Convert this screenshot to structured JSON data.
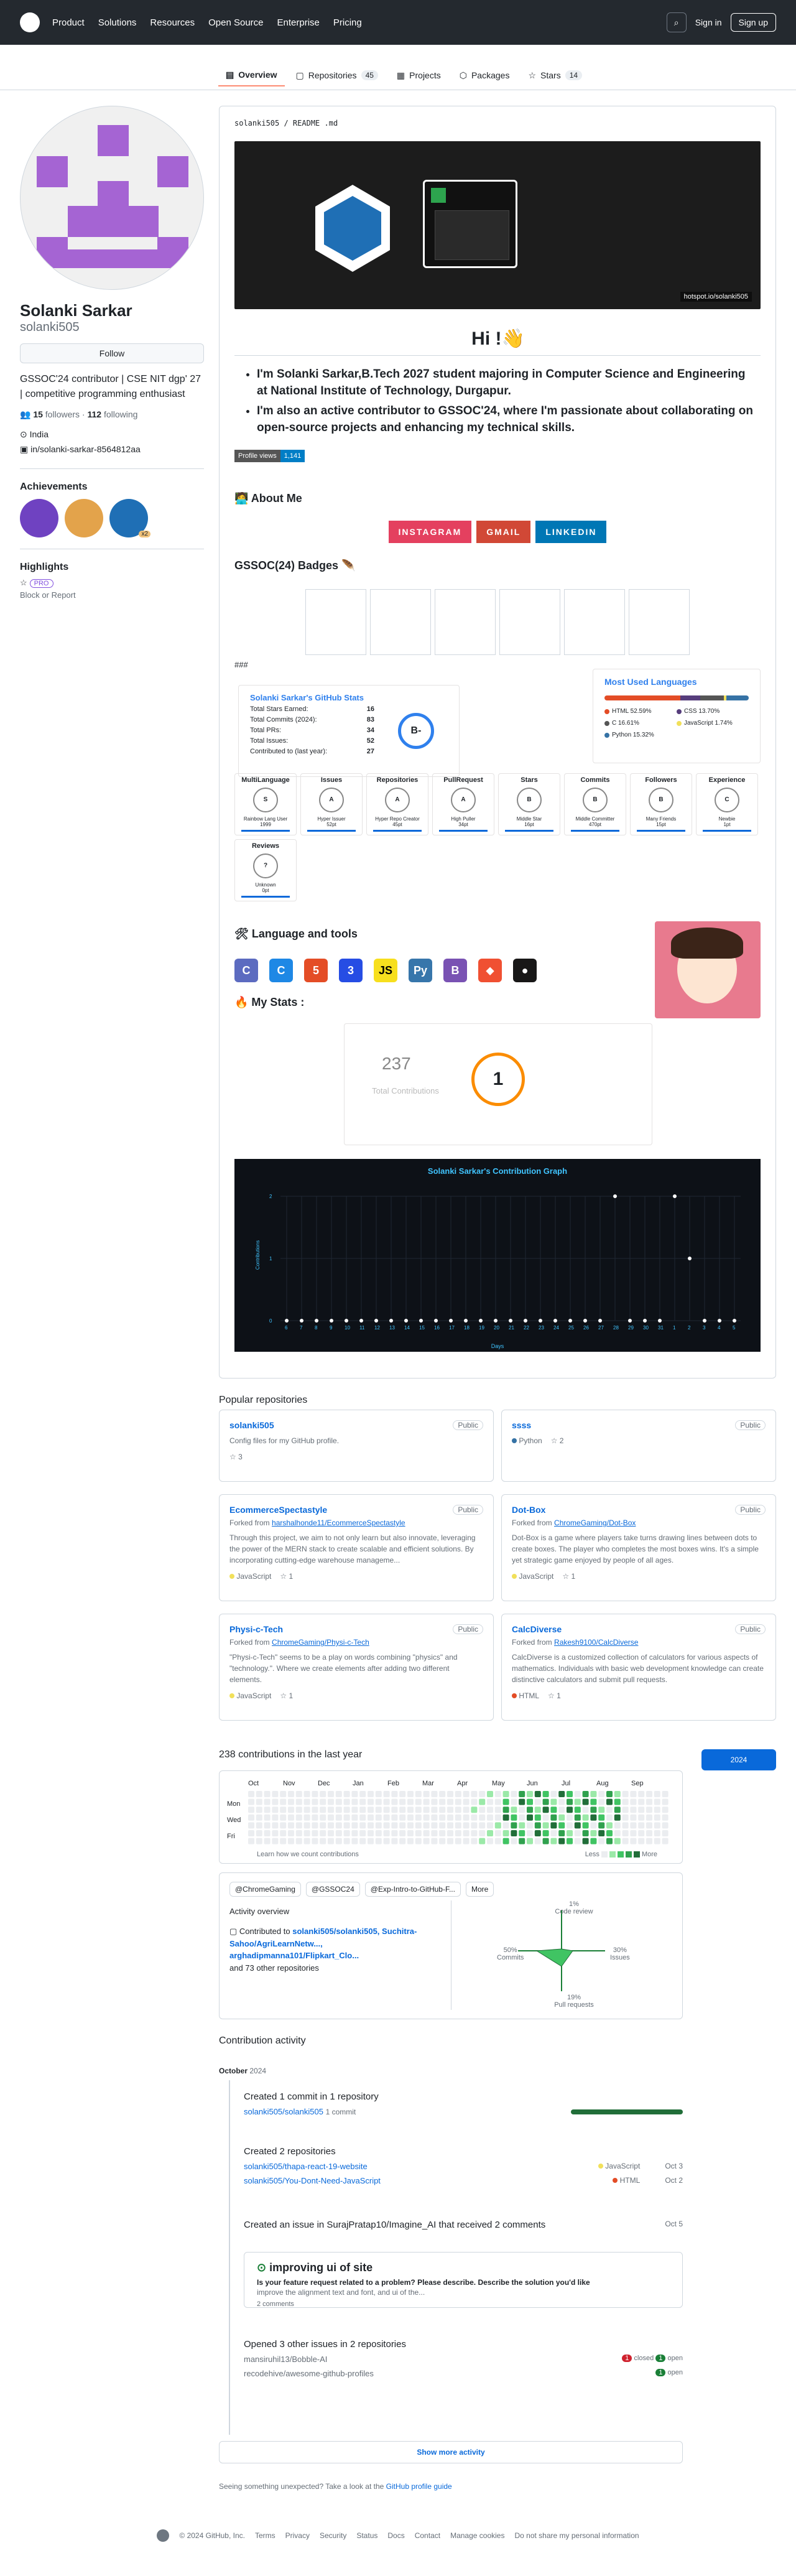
{
  "header": {
    "nav": [
      "Product",
      "Solutions",
      "Resources",
      "Open Source",
      "Enterprise",
      "Pricing"
    ],
    "sign_in": "Sign in",
    "sign_up": "Sign up"
  },
  "tabs": [
    {
      "label": "Overview"
    },
    {
      "label": "Repositories",
      "count": "45"
    },
    {
      "label": "Projects"
    },
    {
      "label": "Packages"
    },
    {
      "label": "Stars",
      "count": "14"
    }
  ],
  "profile": {
    "name": "Solanki Sarkar",
    "login": "solanki505",
    "follow": "Follow",
    "bio": "GSSOC'24 contributor | CSE NIT dgp' 27 | competitive programming enthusiast",
    "followers": "15",
    "followers_label": "followers",
    "following": "112",
    "following_label": "following",
    "location": "India",
    "linkedin": "in/solanki-sarkar-8564812aa",
    "achievements_title": "Achievements",
    "ach_badge": "x2",
    "highlights_title": "Highlights",
    "pro": "PRO",
    "block": "Block or Report"
  },
  "readme": {
    "path": "solanki505 / README .md",
    "credit": "hotspot.io/solanki505",
    "hi": "Hi !👋",
    "intro": [
      "I'm Solanki Sarkar,B.Tech 2027 student majoring in Computer Science and Engineering at National Institute of Technology, Durgapur.",
      "I'm also an active contributor to GSSOC'24, where I'm passionate about collaborating on open-source projects and enhancing my technical skills."
    ],
    "profile_views_label": "Profile views",
    "profile_views": "1,141",
    "about": "🧑‍💻 About Me",
    "socials": [
      {
        "label": "INSTAGRAM",
        "color": "#e4405f"
      },
      {
        "label": "GMAIL",
        "color": "#d14836"
      },
      {
        "label": "LINKEDIN",
        "color": "#0077b5"
      }
    ],
    "gssoc": "GSSOC(24) Badges 🪶",
    "hash": "###",
    "stats": {
      "title": "Solanki Sarkar's GitHub Stats",
      "rows": [
        [
          "Total Stars Earned:",
          "16"
        ],
        [
          "Total Commits (2024):",
          "83"
        ],
        [
          "Total PRs:",
          "34"
        ],
        [
          "Total Issues:",
          "52"
        ],
        [
          "Contributed to (last year):",
          "27"
        ]
      ],
      "grade": "B-"
    },
    "langs": {
      "title": "Most Used Languages",
      "items": [
        {
          "name": "HTML 52.59%",
          "color": "#e34c26",
          "pct": 52.59
        },
        {
          "name": "CSS 13.70%",
          "color": "#563d7c",
          "pct": 13.7
        },
        {
          "name": "C 16.61%",
          "color": "#555555",
          "pct": 16.61
        },
        {
          "name": "JavaScript 1.74%",
          "color": "#f1e05a",
          "pct": 1.74
        },
        {
          "name": "Python 15.32%",
          "color": "#3572A5",
          "pct": 15.32
        }
      ]
    },
    "trophies": [
      {
        "n": "MultiLanguage",
        "g": "S",
        "s": "Rainbow Lang User",
        "p": "1999"
      },
      {
        "n": "Issues",
        "g": "A",
        "s": "Hyper Issuer",
        "p": "52pt"
      },
      {
        "n": "Repositories",
        "g": "A",
        "s": "Hyper Repo Creator",
        "p": "45pt"
      },
      {
        "n": "PullRequest",
        "g": "A",
        "s": "High Puller",
        "p": "34pt"
      },
      {
        "n": "Stars",
        "g": "B",
        "s": "Middle Star",
        "p": "16pt"
      },
      {
        "n": "Commits",
        "g": "B",
        "s": "Middle Committer",
        "p": "470pt"
      },
      {
        "n": "Followers",
        "g": "B",
        "s": "Many Friends",
        "p": "15pt"
      },
      {
        "n": "Experience",
        "g": "C",
        "s": "Newbie",
        "p": "1pt"
      },
      {
        "n": "Reviews",
        "g": "?",
        "s": "Unknown",
        "p": "0pt"
      }
    ],
    "lang_tools": "🛠 Language and tools",
    "tools": [
      {
        "t": "C",
        "c": "#5c6bc0"
      },
      {
        "t": "C",
        "c": "#1e88e5"
      },
      {
        "t": "5",
        "c": "#e44d26"
      },
      {
        "t": "3",
        "c": "#264de4"
      },
      {
        "t": "JS",
        "c": "#f7df1e"
      },
      {
        "t": "Py",
        "c": "#3776ab"
      },
      {
        "t": "B",
        "c": "#7952b3"
      },
      {
        "t": "⬥",
        "c": "#f05032"
      },
      {
        "t": "●",
        "c": "#181717"
      }
    ],
    "my_stats": "🔥 My Stats :",
    "streak": {
      "total": "237",
      "label": "Total Contributions",
      "current": "1"
    },
    "graph_title": "Solanki Sarkar's Contribution Graph",
    "graph_y": "Contributions",
    "graph_x": "Days",
    "graph_ticks": [
      "6",
      "7",
      "8",
      "9",
      "10",
      "11",
      "12",
      "13",
      "14",
      "15",
      "16",
      "17",
      "18",
      "19",
      "20",
      "21",
      "22",
      "23",
      "24",
      "25",
      "26",
      "27",
      "28",
      "29",
      "30",
      "31",
      "1",
      "2",
      "3",
      "4",
      "5"
    ],
    "graph_y_ticks": [
      "0",
      "1",
      "2"
    ]
  },
  "popular": {
    "title": "Popular repositories",
    "repos": [
      {
        "name": "solanki505",
        "pub": "Public",
        "desc": "Config files for my GitHub profile.",
        "stars": "3"
      },
      {
        "name": "ssss",
        "pub": "Public",
        "lang": "Python",
        "lc": "#3572A5",
        "stars": "2"
      },
      {
        "name": "EcommerceSpectastyle",
        "pub": "Public",
        "forked": "Forked from",
        "from": "harshalhonde11/EcommerceSpectastyle",
        "desc": "Through this project, we aim to not only learn but also innovate, leveraging the power of the MERN stack to create scalable and efficient solutions. By incorporating cutting-edge warehouse manageme...",
        "lang": "JavaScript",
        "lc": "#f1e05a",
        "stars": "1"
      },
      {
        "name": "Dot-Box",
        "pub": "Public",
        "forked": "Forked from",
        "from": "ChromeGaming/Dot-Box",
        "desc": "Dot-Box is a game where players take turns drawing lines between dots to create boxes. The player who completes the most boxes wins. It's a simple yet strategic game enjoyed by people of all ages.",
        "lang": "JavaScript",
        "lc": "#f1e05a",
        "stars": "1"
      },
      {
        "name": "Physi-c-Tech",
        "pub": "Public",
        "forked": "Forked from",
        "from": "ChromeGaming/Physi-c-Tech",
        "desc": "\"Physi-c-Tech\" seems to be a play on words combining \"physics\" and \"technology.\". Where we create elements after adding two different elements.",
        "lang": "JavaScript",
        "lc": "#f1e05a",
        "stars": "1"
      },
      {
        "name": "CalcDiverse",
        "pub": "Public",
        "forked": "Forked from",
        "from": "Rakesh9100/CalcDiverse",
        "desc": "CalcDiverse is a customized collection of calculators for various aspects of mathematics. Individuals with basic web development knowledge can create distinctive calculators and submit pull requests.",
        "lang": "HTML",
        "lc": "#e34c26",
        "stars": "1"
      }
    ]
  },
  "contrib": {
    "title": "238 contributions in the last year",
    "year": "2024",
    "months": [
      "Oct",
      "Nov",
      "Dec",
      "Jan",
      "Feb",
      "Mar",
      "Apr",
      "May",
      "Jun",
      "Jul",
      "Aug",
      "Sep"
    ],
    "days": [
      "Mon",
      "Wed",
      "Fri"
    ],
    "learn": "Learn how we count contributions",
    "less": "Less",
    "more": "More"
  },
  "overview": {
    "orgs": [
      "@ChromeGaming",
      "@GSSOC24",
      "@Exp-Intro-to-GitHub-F...",
      "More"
    ],
    "title": "Activity overview",
    "contributed": "Contributed to",
    "repos": "solanki505/solanki505, Suchitra-Sahoo/AgriLearnNetw..., arghadipmanna101/Flipkart_Clo...",
    "others": "and 73 other repositories",
    "code_review": "1%",
    "code_review_l": "Code review",
    "commits": "50%",
    "commits_l": "Commits",
    "issues": "30%",
    "issues_l": "Issues",
    "prs": "19%",
    "prs_l": "Pull requests"
  },
  "activity": {
    "title": "Contribution activity",
    "month": "October",
    "year": "2024",
    "a1": "Created 1 commit in 1 repository",
    "a1_repo": "solanki505/solanki505",
    "a1_count": "1 commit",
    "a2": "Created 2 repositories",
    "a2_r1": "solanki505/thapa-react-19-website",
    "a2_r1_lang": "JavaScript",
    "a2_r1_date": "Oct 3",
    "a2_r2": "solanki505/You-Dont-Need-JavaScript",
    "a2_r2_lang": "HTML",
    "a2_r2_date": "Oct 2",
    "a3": "Created an issue in SurajPratap10/Imagine_AI that received 2 comments",
    "a3_date": "Oct 5",
    "issue_title": "improving ui of site",
    "issue_q": "Is your feature request related to a problem? Please describe. Describe the solution you'd like",
    "issue_body": "improve the alignment text and font, and ui of the...",
    "issue_comments": "2 comments",
    "a4": "Opened 3 other issues in 2 repositories",
    "a4_r1": "mansiruhil13/Bobble-AI",
    "a4_r1_closed": "1",
    "a4_r1_closed_l": "closed",
    "a4_r1_open": "1",
    "a4_r1_open_l": "open",
    "a4_r2": "recodehive/awesome-github-profiles",
    "a4_r2_open": "1",
    "a4_r2_open_l": "open",
    "show_more": "Show more activity",
    "seeing": "Seeing something unexpected? Take a look at the",
    "guide": "GitHub profile guide"
  },
  "footer": [
    "© 2024 GitHub, Inc.",
    "Terms",
    "Privacy",
    "Security",
    "Status",
    "Docs",
    "Contact",
    "Manage cookies",
    "Do not share my personal information"
  ]
}
